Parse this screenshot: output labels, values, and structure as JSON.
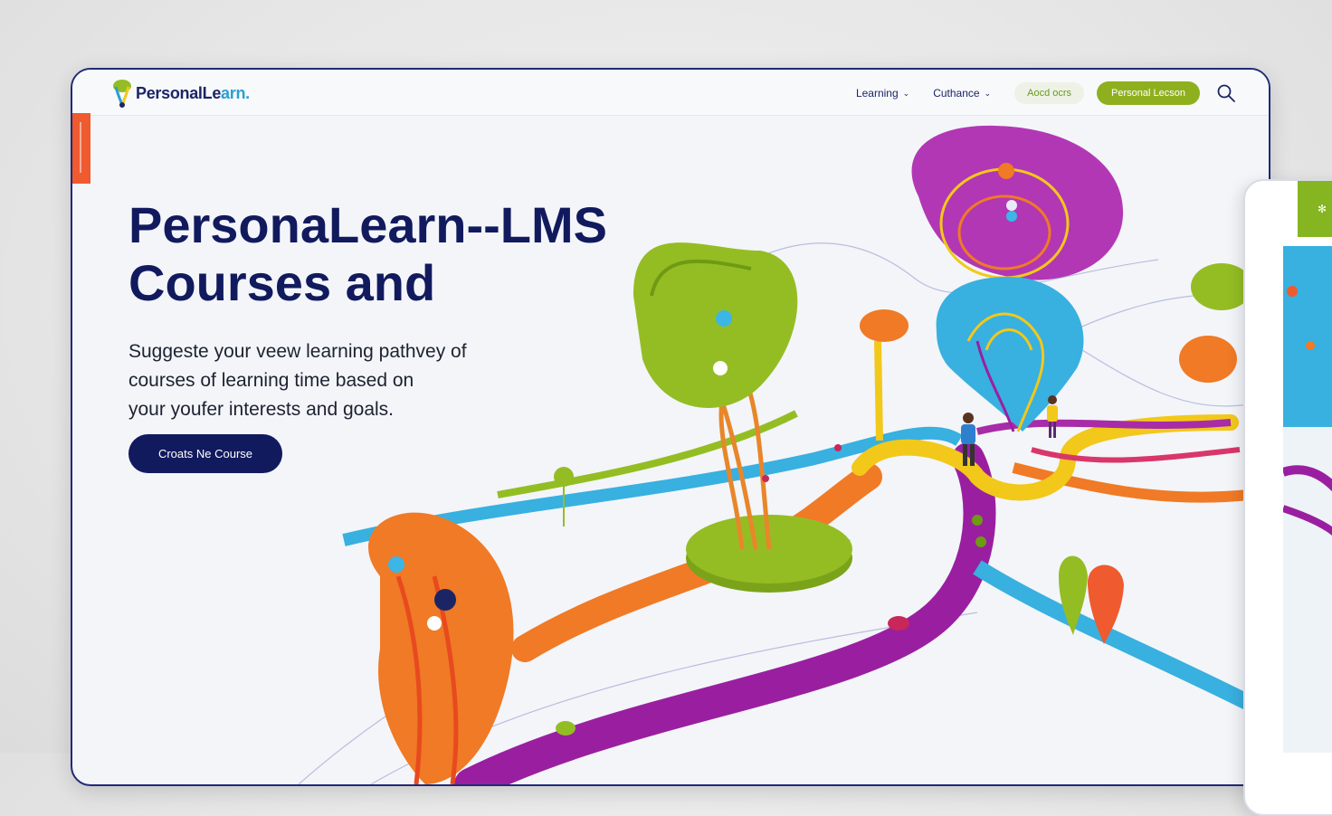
{
  "brand": {
    "name_main": "PersonalLe",
    "name_accent": "arn."
  },
  "nav": {
    "items": [
      {
        "label": "Learning",
        "icon": "chevron-down-icon"
      },
      {
        "label": "Cuthance",
        "icon": "chevron-down-icon"
      }
    ],
    "ghost_button": "Aocd ocrs",
    "primary_button": "Personal Lecson",
    "search_icon": "search-icon"
  },
  "hero": {
    "title": "PersonaLearn--LMS Courses and",
    "subtitle_lines": [
      "Suggeste your veew learning pathvey of",
      "courses of learning time based on",
      "your youfer interests and goals."
    ],
    "cta_label": "Croats Ne Course"
  },
  "colors": {
    "navy": "#121a5e",
    "lime": "#8fb01e",
    "orange": "#ef5a2f",
    "purple": "#9b1f9e",
    "blue": "#2fa8dc",
    "yellow": "#f2c81a"
  }
}
